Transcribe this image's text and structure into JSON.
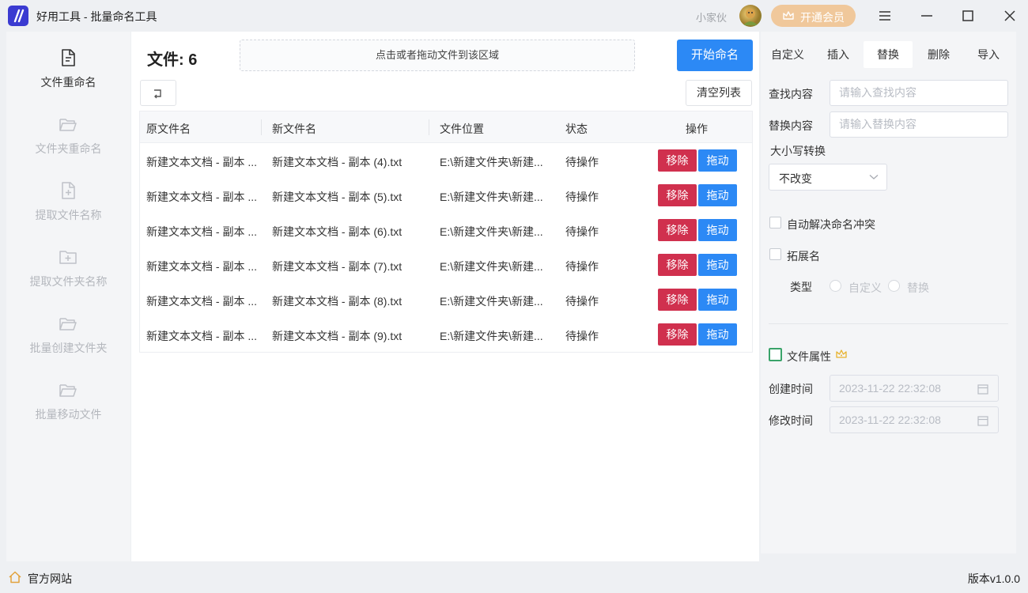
{
  "window": {
    "title": "好用工具 - 批量命名工具",
    "username": "小家伙",
    "vip_label": "开通会员"
  },
  "sidebar": {
    "items": [
      {
        "label": "文件重命名",
        "icon": "file-icon",
        "active": true
      },
      {
        "label": "文件夹重命名",
        "icon": "folder-open-icon",
        "active": false
      },
      {
        "label": "提取文件名称",
        "icon": "file-plus-icon",
        "active": false
      },
      {
        "label": "提取文件夹名称",
        "icon": "folder-plus-icon",
        "active": false
      },
      {
        "label": "批量创建文件夹",
        "icon": "folder-open-icon",
        "active": false
      },
      {
        "label": "批量移动文件",
        "icon": "folder-open-icon",
        "active": false
      }
    ]
  },
  "main": {
    "file_count_label": "文件: 6",
    "dropzone_text": "点击或者拖动文件到该区域",
    "start_button": "开始命名",
    "clear_button": "清空列表",
    "columns": [
      "原文件名",
      "新文件名",
      "文件位置",
      "状态",
      "操作"
    ],
    "rows": [
      {
        "original": "新建文本文档 - 副本 ...",
        "new_name": "新建文本文档 - 副本 (4).txt",
        "location": "E:\\新建文件夹\\新建...",
        "status": "待操作",
        "remove": "移除",
        "drag": "拖动"
      },
      {
        "original": "新建文本文档 - 副本 ...",
        "new_name": "新建文本文档 - 副本 (5).txt",
        "location": "E:\\新建文件夹\\新建...",
        "status": "待操作",
        "remove": "移除",
        "drag": "拖动"
      },
      {
        "original": "新建文本文档 - 副本 ...",
        "new_name": "新建文本文档 - 副本 (6).txt",
        "location": "E:\\新建文件夹\\新建...",
        "status": "待操作",
        "remove": "移除",
        "drag": "拖动"
      },
      {
        "original": "新建文本文档 - 副本 ...",
        "new_name": "新建文本文档 - 副本 (7).txt",
        "location": "E:\\新建文件夹\\新建...",
        "status": "待操作",
        "remove": "移除",
        "drag": "拖动"
      },
      {
        "original": "新建文本文档 - 副本 ...",
        "new_name": "新建文本文档 - 副本 (8).txt",
        "location": "E:\\新建文件夹\\新建...",
        "status": "待操作",
        "remove": "移除",
        "drag": "拖动"
      },
      {
        "original": "新建文本文档 - 副本 ...",
        "new_name": "新建文本文档 - 副本 (9).txt",
        "location": "E:\\新建文件夹\\新建...",
        "status": "待操作",
        "remove": "移除",
        "drag": "拖动"
      }
    ]
  },
  "settings": {
    "tabs": [
      {
        "label": "自定义",
        "active": false
      },
      {
        "label": "插入",
        "active": false
      },
      {
        "label": "替换",
        "active": true
      },
      {
        "label": "删除",
        "active": false
      },
      {
        "label": "导入",
        "active": false
      }
    ],
    "find_label": "查找内容",
    "find_placeholder": "请输入查找内容",
    "replace_label": "替换内容",
    "replace_placeholder": "请输入替换内容",
    "case_label": "大小写转换",
    "case_value": "不改变",
    "auto_resolve_label": "自动解决命名冲突",
    "extension_label": "拓展名",
    "type_label": "类型",
    "type_options": [
      "自定义",
      "替换"
    ],
    "file_attr_label": "文件属性",
    "created_label": "创建时间",
    "created_value": "2023-11-22 22:32:08",
    "modified_label": "修改时间",
    "modified_value": "2023-11-22 22:32:08"
  },
  "statusbar": {
    "site_label": "官方网站",
    "version": "版本v1.0.0"
  },
  "colors": {
    "primary": "#2c89f5",
    "danger": "#d0304e",
    "vip": "#f0c89b",
    "logo": "#3b3bd1"
  }
}
